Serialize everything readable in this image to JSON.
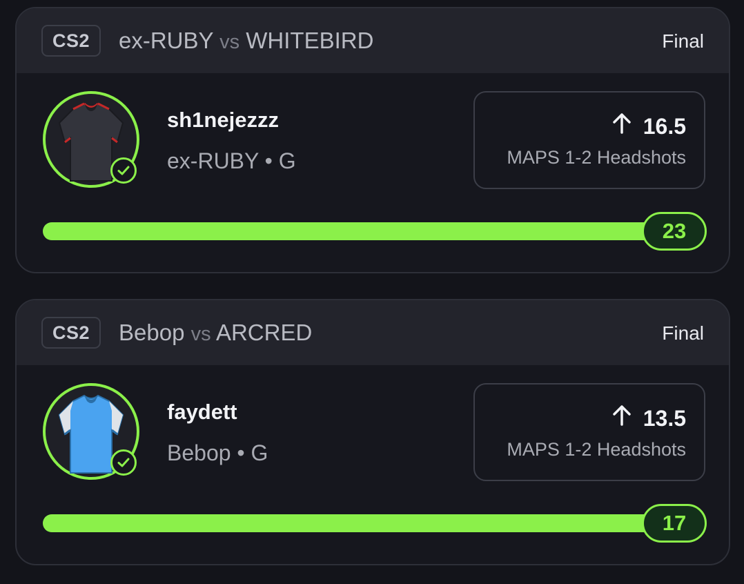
{
  "colors": {
    "accent_green": "#8bf04a",
    "card_bg": "#16171e",
    "header_bg": "#23242c"
  },
  "cards": [
    {
      "game": "CS2",
      "team_a": "ex-RUBY",
      "vs": "vs",
      "team_b": "WHITEBIRD",
      "status": "Final",
      "player_name": "sh1nejezzz",
      "player_team": "ex-RUBY • G",
      "direction_icon": "arrow-up-icon",
      "line": "16.5",
      "stat": "MAPS 1-2 Headshots",
      "result": "23",
      "progress_fraction": 1.0,
      "jersey": "dark-jersey"
    },
    {
      "game": "CS2",
      "team_a": "Bebop",
      "vs": "vs",
      "team_b": "ARCRED",
      "status": "Final",
      "player_name": "faydett",
      "player_team": "Bebop • G",
      "direction_icon": "arrow-up-icon",
      "line": "13.5",
      "stat": "MAPS 1-2 Headshots",
      "result": "17",
      "progress_fraction": 1.0,
      "jersey": "blue-jersey"
    }
  ]
}
